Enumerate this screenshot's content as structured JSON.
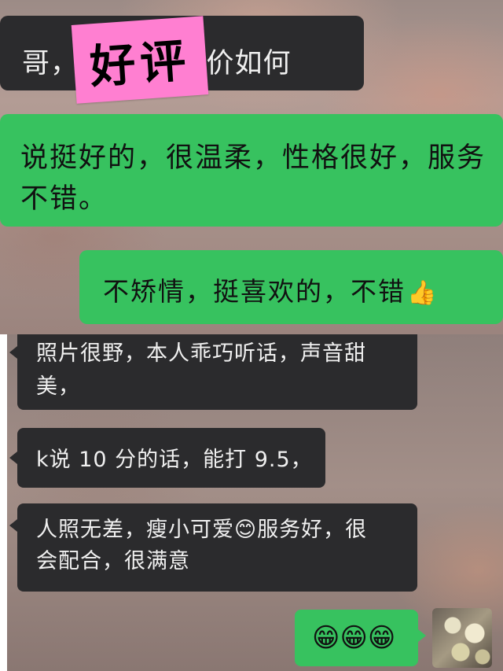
{
  "sticker": {
    "label": "好评"
  },
  "messages": [
    {
      "side": "left",
      "text": "哥，　　　　评价如何"
    },
    {
      "side": "right",
      "text": "说挺好的，很温柔，性格很好，服务不错。"
    },
    {
      "side": "right",
      "text": "不矫情，挺喜欢的，不错",
      "emoji": "👍"
    },
    {
      "side": "left",
      "line1": "照片很野，本人乖巧听话，声音甜",
      "line2": "美，"
    },
    {
      "side": "left",
      "text": "k说 10 分的话，能打 9.5，"
    },
    {
      "side": "left",
      "line1": "人照无差，瘦小可爱😊服务好，很",
      "line2": "会配合，很满意"
    },
    {
      "side": "right",
      "text": "😁😁😁"
    }
  ],
  "colors": {
    "incoming_bubble": "#2b2b2d",
    "outgoing_bubble": "#37c25f",
    "sticker": "#ff7fd1"
  },
  "avatar": {
    "icon": "avatar-photo"
  }
}
